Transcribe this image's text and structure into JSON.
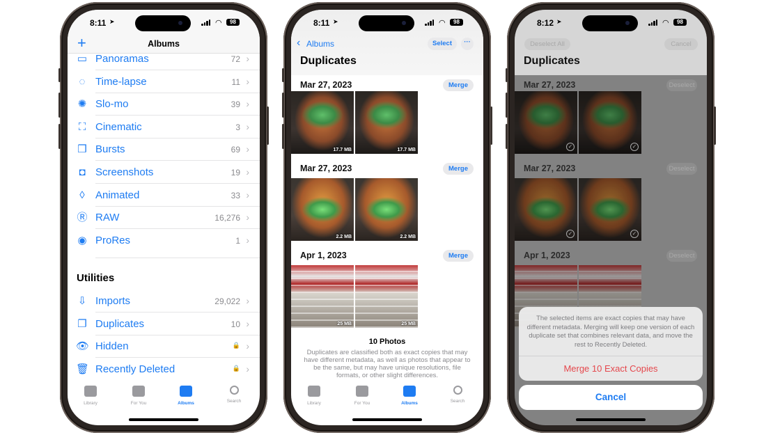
{
  "accent_color": "#1e7cf2",
  "destructive_color": "#e5484d",
  "status": {
    "battery": "98",
    "wifi_icon": "wifi-icon",
    "signal_icon": "cellular-signal-icon"
  },
  "tabbar": [
    {
      "label": "Library",
      "icon": "photo-stack-icon"
    },
    {
      "label": "For You",
      "icon": "for-you-icon"
    },
    {
      "label": "Albums",
      "icon": "albums-icon",
      "active": true
    },
    {
      "label": "Search",
      "icon": "search-icon"
    }
  ],
  "albums_screen": {
    "time": "8:11",
    "title": "Albums",
    "add_icon": "plus-icon",
    "media_types": [
      {
        "label": "Panoramas",
        "count": "72",
        "icon": "panorama-icon",
        "glyph": "▭"
      },
      {
        "label": "Time-lapse",
        "count": "11",
        "icon": "timelapse-icon",
        "glyph": "◌"
      },
      {
        "label": "Slo-mo",
        "count": "39",
        "icon": "slomo-icon",
        "glyph": "✺"
      },
      {
        "label": "Cinematic",
        "count": "3",
        "icon": "cinematic-icon",
        "glyph": "⛶"
      },
      {
        "label": "Bursts",
        "count": "69",
        "icon": "bursts-icon",
        "glyph": "❒"
      },
      {
        "label": "Screenshots",
        "count": "19",
        "icon": "screenshot-icon",
        "glyph": "◘"
      },
      {
        "label": "Animated",
        "count": "33",
        "icon": "animated-icon",
        "glyph": "◊"
      },
      {
        "label": "RAW",
        "count": "16,276",
        "icon": "raw-icon",
        "glyph": "Ⓡ"
      },
      {
        "label": "ProRes",
        "count": "1",
        "icon": "prores-icon",
        "glyph": "◉"
      }
    ],
    "utilities_heading": "Utilities",
    "utilities": [
      {
        "label": "Imports",
        "count": "29,022",
        "icon": "import-icon",
        "glyph": "⇩"
      },
      {
        "label": "Duplicates",
        "count": "10",
        "icon": "duplicates-icon",
        "glyph": "❐"
      },
      {
        "label": "Hidden",
        "count": "🔒",
        "icon": "eye-slash-icon",
        "glyph": "👁"
      },
      {
        "label": "Recently Deleted",
        "count": "🔒",
        "icon": "trash-icon",
        "glyph": "🗑"
      }
    ]
  },
  "duplicates_screen": {
    "time": "8:11",
    "back_label": "Albums",
    "select_label": "Select",
    "more_icon": "ellipsis-icon",
    "title": "Duplicates",
    "groups": [
      {
        "date": "Mar 27, 2023",
        "action": "Merge",
        "photos": [
          {
            "size": "17.7 MB",
            "kind": "skull"
          },
          {
            "size": "17.7 MB",
            "kind": "skull"
          }
        ]
      },
      {
        "date": "Mar 27, 2023",
        "action": "Merge",
        "photos": [
          {
            "size": "2.2 MB",
            "kind": "skull2"
          },
          {
            "size": "2.2 MB",
            "kind": "skull2"
          }
        ]
      },
      {
        "date": "Apr 1, 2023",
        "action": "Merge",
        "photos": [
          {
            "size": "25 MB",
            "kind": "flag"
          },
          {
            "size": "25 MB",
            "kind": "flag"
          }
        ]
      }
    ],
    "footer_count": "10 Photos",
    "footer_text": "Duplicates are classified both as exact copies that may have different metadata, as well as photos that appear to be the same, but may have unique resolutions, file formats, or other slight differences."
  },
  "merge_screen": {
    "time": "8:12",
    "deselect_all_label": "Deselect All",
    "cancel_top_label": "Cancel",
    "title": "Duplicates",
    "groups": [
      {
        "date": "Mar 27, 2023",
        "action": "Deselect"
      },
      {
        "date": "Mar 27, 2023",
        "action": "Deselect"
      },
      {
        "date": "Apr 1, 2023",
        "action": "Deselect"
      }
    ],
    "sheet_message": "The selected items are exact copies that may have different metadata. Merging will keep one version of each duplicate set that combines relevant data, and move the rest to Recently Deleted.",
    "merge_button": "Merge 10 Exact Copies",
    "cancel_button": "Cancel"
  }
}
